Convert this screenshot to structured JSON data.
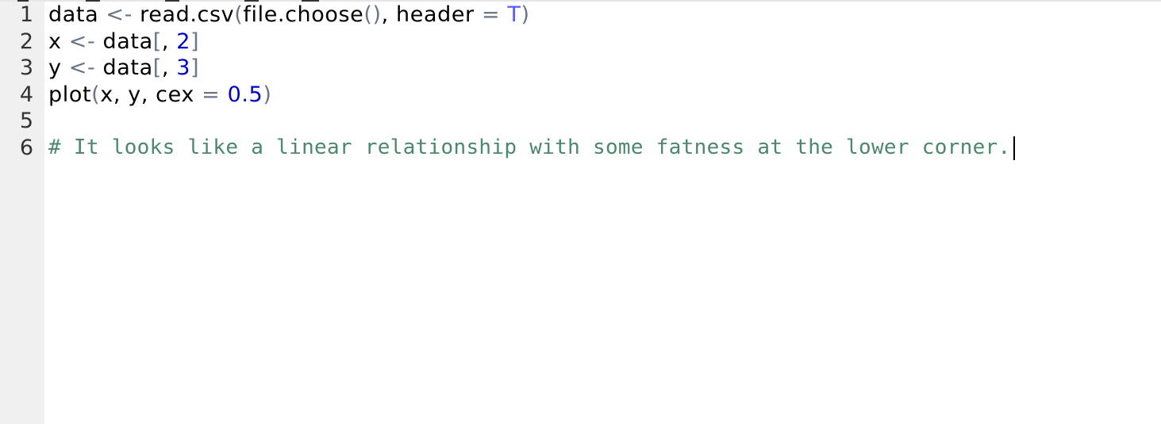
{
  "editor": {
    "line_numbers": [
      "1",
      "2",
      "3",
      "4",
      "5",
      "6"
    ],
    "lines": [
      {
        "tokens": [
          {
            "type": "id",
            "text": "data "
          },
          {
            "type": "op",
            "text": "<-"
          },
          {
            "type": "id",
            "text": " read.csv"
          },
          {
            "type": "paren",
            "text": "("
          },
          {
            "type": "id",
            "text": "file.choose"
          },
          {
            "type": "paren",
            "text": "()"
          },
          {
            "type": "id",
            "text": ", header "
          },
          {
            "type": "op",
            "text": "="
          },
          {
            "type": "id",
            "text": " "
          },
          {
            "type": "const",
            "text": "T"
          },
          {
            "type": "paren",
            "text": ")"
          }
        ]
      },
      {
        "tokens": [
          {
            "type": "id",
            "text": "x "
          },
          {
            "type": "op",
            "text": "<-"
          },
          {
            "type": "id",
            "text": " data"
          },
          {
            "type": "paren",
            "text": "["
          },
          {
            "type": "id",
            "text": ", "
          },
          {
            "type": "num",
            "text": "2"
          },
          {
            "type": "paren",
            "text": "]"
          }
        ]
      },
      {
        "tokens": [
          {
            "type": "id",
            "text": "y "
          },
          {
            "type": "op",
            "text": "<-"
          },
          {
            "type": "id",
            "text": " data"
          },
          {
            "type": "paren",
            "text": "["
          },
          {
            "type": "id",
            "text": ", "
          },
          {
            "type": "num",
            "text": "3"
          },
          {
            "type": "paren",
            "text": "]"
          }
        ]
      },
      {
        "tokens": [
          {
            "type": "id",
            "text": "plot"
          },
          {
            "type": "paren",
            "text": "("
          },
          {
            "type": "id",
            "text": "x, y, cex "
          },
          {
            "type": "op",
            "text": "="
          },
          {
            "type": "id",
            "text": " "
          },
          {
            "type": "num",
            "text": "0.5"
          },
          {
            "type": "paren",
            "text": ")"
          }
        ]
      },
      {
        "tokens": []
      },
      {
        "tokens": [
          {
            "type": "comment",
            "text": "# It looks like a linear relationship with some fatness at the lower corner."
          }
        ],
        "mono": true,
        "cursor": true
      }
    ]
  },
  "colors": {
    "identifier": "#000000",
    "operator": "#687687",
    "number": "#0000cd",
    "constant": "#585cf6",
    "comment": "#4c886b",
    "gutter_background": "#f0f0f0",
    "editor_background": "#ffffff"
  }
}
